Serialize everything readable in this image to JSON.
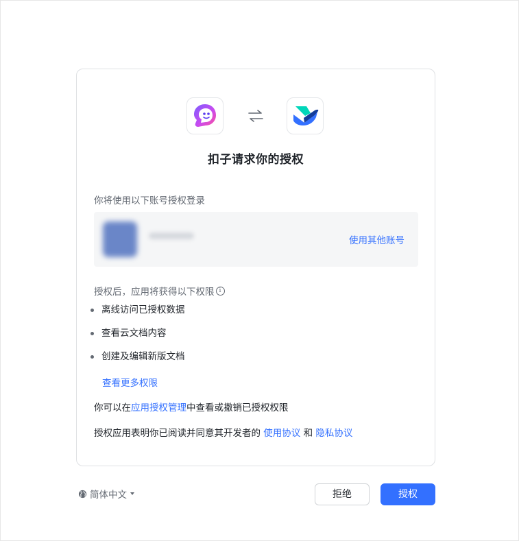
{
  "dialog": {
    "title": "扣子请求你的授权",
    "account_section_label": "你将使用以下账号授权登录",
    "switch_account_label": "使用其他账号",
    "permissions_label": "授权后，应用将获得以下权限",
    "permissions": [
      "离线访问已授权数据",
      "查看云文档内容",
      "创建及编辑新版文档"
    ],
    "more_permissions_label": "查看更多权限",
    "manage": {
      "prefix": "你可以在",
      "link": "应用授权管理",
      "suffix": "中查看或撤销已授权权限"
    },
    "agreement": {
      "prefix": "授权应用表明你已阅读并同意其开发者的 ",
      "terms_link": "使用协议",
      "middle": " 和 ",
      "privacy_link": "隐私协议"
    }
  },
  "footer": {
    "language": "简体中文",
    "deny_label": "拒绝",
    "authorize_label": "授权"
  },
  "colors": {
    "accent": "#3370ff",
    "text": "#1f2329",
    "secondary_text": "#646a73"
  },
  "icons": {
    "left_app": "coze-app-logo",
    "right_app": "feishu-lark-logo",
    "swap": "swap-arrows-icon",
    "info": "info-icon",
    "language": "globe-icon"
  }
}
